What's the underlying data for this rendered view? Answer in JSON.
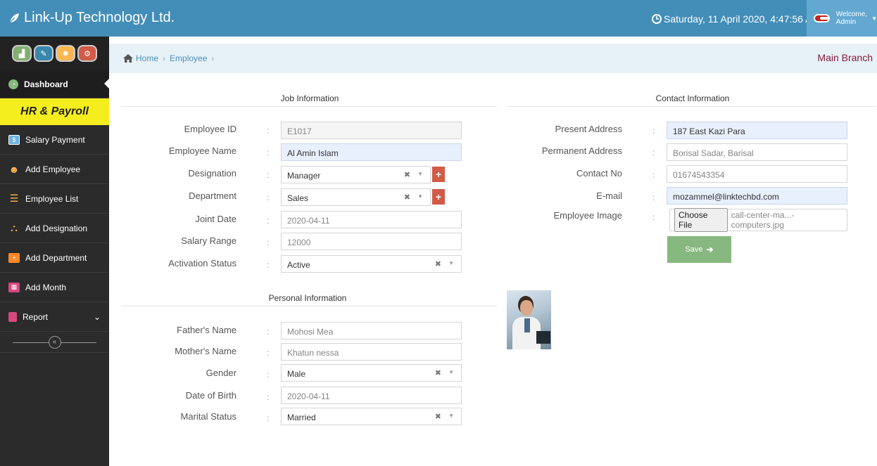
{
  "header": {
    "brand": "Link-Up Technology Ltd.",
    "datetime": "Saturday, 11 April 2020, 4:47:56 AM",
    "welcome": "Welcome,",
    "user": "Admin"
  },
  "sidebar": {
    "dashboard": "Dashboard",
    "section": "HR & Payroll",
    "items": [
      {
        "label": "Salary Payment",
        "icon": "money-icon",
        "color": "#6fb3e0"
      },
      {
        "label": "Add Employee",
        "icon": "users-icon",
        "color": "#ffb752"
      },
      {
        "label": "Employee List",
        "icon": "list-icon",
        "color": "#ffb752"
      },
      {
        "label": "Add Designation",
        "icon": "binoculars-icon",
        "color": "#ffb752"
      },
      {
        "label": "Add Department",
        "icon": "plus-square-icon",
        "color": "#ff892a"
      },
      {
        "label": "Add Month",
        "icon": "calendar-icon",
        "color": "#d6487e"
      },
      {
        "label": "Report",
        "icon": "file-icon",
        "color": "#d6487e"
      }
    ]
  },
  "breadcrumb": {
    "home": "Home",
    "current": "Employee",
    "branch": "Main Branch"
  },
  "job": {
    "title": "Job Information",
    "employee_id_label": "Employee ID",
    "employee_id": "E1017",
    "employee_name_label": "Employee Name",
    "employee_name": "Al Amin Islam",
    "designation_label": "Designation",
    "designation": "Manager",
    "department_label": "Department",
    "department": "Sales",
    "joint_date_label": "Joint Date",
    "joint_date": "2020-04-11",
    "salary_range_label": "Salary Range",
    "salary_range": "12000",
    "activation_label": "Activation Status",
    "activation": "Active"
  },
  "personal": {
    "title": "Personal Information",
    "father_label": "Father's Name",
    "father": "Mohosi Mea",
    "mother_label": "Mother's Name",
    "mother": "Khatun nessa",
    "gender_label": "Gender",
    "gender": "Male",
    "dob_label": "Date of Birth",
    "dob": "2020-04-11",
    "marital_label": "Marital Status",
    "marital": "Married"
  },
  "contact": {
    "title": "Contact Information",
    "present_label": "Present Address",
    "present": "187 East Kazi Para",
    "permanent_label": "Permanent Address",
    "permanent": "Borisal Sadar, Barisal",
    "contact_label": "Contact No",
    "contact": "01674543354",
    "email_label": "E-mail",
    "email": "mozammel@linktechbd.com",
    "image_label": "Employee Image",
    "choose_file": "Choose File",
    "file_name": "call-center-ma...-computers.jpg",
    "save": "Save"
  },
  "colon": ":"
}
